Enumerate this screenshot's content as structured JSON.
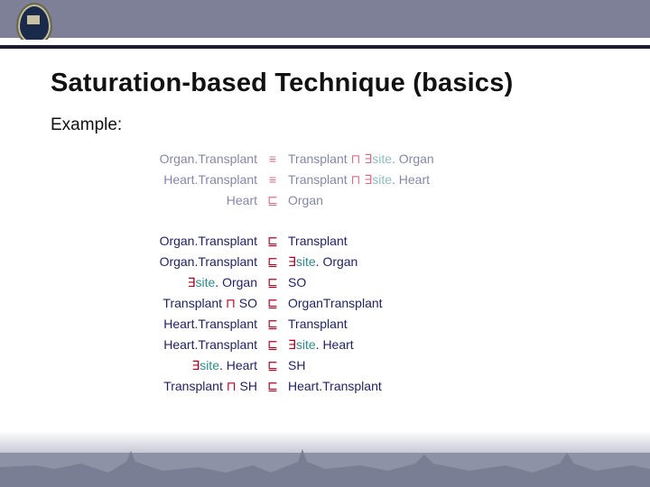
{
  "header": {
    "title": "Saturation-based Technique (basics)"
  },
  "labels": {
    "example": "Example:"
  },
  "symbols": {
    "equiv": "≡",
    "subcls": "⊑",
    "sqcap": "⊓",
    "exists": "∃"
  },
  "tokens": {
    "OrganTransplant": "Organ.Transplant",
    "HeartTransplant": "Heart.Transplant",
    "Transplant": "Transplant",
    "Organ": "Organ",
    "Heart": "Heart",
    "site": "site",
    "SO": "SO",
    "SH": "SH",
    "OrganTransplant2": "OrganTransplant"
  },
  "axioms_faded": [
    {
      "lhs": [
        "Organ.Transplant"
      ],
      "rel": "≡",
      "rhs": [
        "Transplant",
        " ⊓ ",
        "∃",
        "site",
        ". ",
        "Organ"
      ]
    },
    {
      "lhs": [
        "Heart.Transplant"
      ],
      "rel": "≡",
      "rhs": [
        "Transplant",
        " ⊓ ",
        "∃",
        "site",
        ". ",
        "Heart"
      ]
    },
    {
      "lhs": [
        "Heart"
      ],
      "rel": "⊑",
      "rhs": [
        "Organ"
      ]
    }
  ],
  "axioms_main": [
    {
      "lhs": [
        "Organ.Transplant"
      ],
      "rel": "⊑",
      "rhs": [
        "Transplant"
      ]
    },
    {
      "lhs": [
        "Organ.Transplant"
      ],
      "rel": "⊑",
      "rhs": [
        "∃",
        "site",
        ". ",
        "Organ"
      ]
    },
    {
      "lhs": [
        "∃",
        "site",
        ". ",
        "Organ"
      ],
      "rel": "⊑",
      "rhs": [
        "SO"
      ]
    },
    {
      "lhs": [
        "Transplant",
        " ⊓ ",
        "SO"
      ],
      "rel": "⊑",
      "rhs": [
        "OrganTransplant"
      ]
    },
    {
      "lhs": [
        "Heart.Transplant"
      ],
      "rel": "⊑",
      "rhs": [
        "Transplant"
      ]
    },
    {
      "lhs": [
        "Heart.Transplant"
      ],
      "rel": "⊑",
      "rhs": [
        "∃",
        "site",
        ". ",
        "Heart"
      ]
    },
    {
      "lhs": [
        "∃",
        "site",
        ". ",
        "Heart"
      ],
      "rel": "⊑",
      "rhs": [
        "SH"
      ]
    },
    {
      "lhs": [
        "Transplant",
        " ⊓ ",
        "SH"
      ],
      "rel": "⊑",
      "rhs": [
        "Heart.Transplant"
      ]
    }
  ]
}
